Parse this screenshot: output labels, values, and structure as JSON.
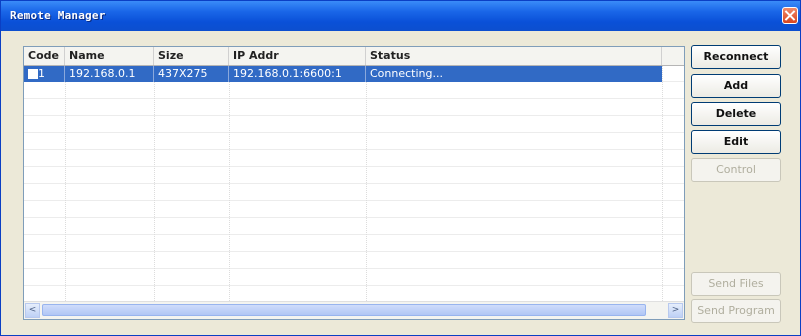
{
  "window": {
    "title": "Remote Manager"
  },
  "table": {
    "columns": [
      "Code",
      "Name",
      "Size",
      "IP Addr",
      "Status"
    ],
    "rows": [
      {
        "code": "1",
        "name": "192.168.0.1",
        "size": "437X275",
        "ip": "192.168.0.1:6600:1",
        "status": "Connecting...",
        "checked": false,
        "selected": true
      }
    ]
  },
  "buttons": {
    "reconnect": "Reconnect",
    "add": "Add",
    "delete": "Delete",
    "edit": "Edit",
    "control": "Control",
    "send_files": "Send Files",
    "send_program": "Send Program"
  },
  "scroll": {
    "left_arrow": "<",
    "right_arrow": ">"
  },
  "colors": {
    "titlebar": "#0a50d8",
    "selection": "#316ac5",
    "close": "#d9451e"
  },
  "icons": {
    "close": "close-icon"
  }
}
